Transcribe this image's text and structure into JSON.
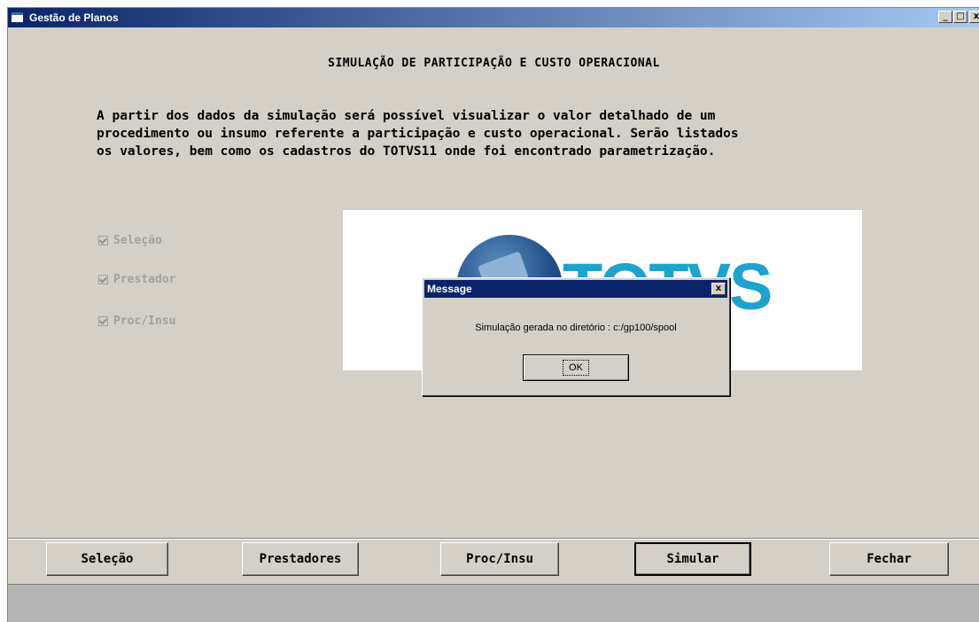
{
  "window": {
    "title": "Gestão de Planos",
    "controls": {
      "minimize": "_",
      "maximize": "□",
      "close": "x"
    }
  },
  "main": {
    "heading": "SIMULAÇÃO DE PARTICIPAÇÃO E CUSTO OPERACIONAL",
    "description_lines": [
      "A partir dos dados da simulação será possível visualizar o valor detalhado de um",
      "procedimento ou insumo referente a participação e custo operacional. Serão listados",
      "os valores, bem como os cadastros do TOTVS11 onde foi encontrado parametrização."
    ],
    "checkboxes": [
      {
        "label": "Seleção",
        "checked": true
      },
      {
        "label": "Prestador",
        "checked": true
      },
      {
        "label": "Proc/Insu",
        "checked": true
      }
    ],
    "logo_text": "TOTVS"
  },
  "dialog": {
    "title": "Message",
    "close": "x",
    "message": "Simulação gerada no diretório : c:/gp100/spool",
    "ok_label": "OK"
  },
  "buttons": [
    {
      "label": "Seleção"
    },
    {
      "label": "Prestadores"
    },
    {
      "label": "Proc/Insu"
    },
    {
      "label": "Simular"
    },
    {
      "label": "Fechar"
    }
  ],
  "colors": {
    "titlebar": "#0a246a",
    "face": "#d4d0c8",
    "logo_accent": "#1ea3cf"
  }
}
